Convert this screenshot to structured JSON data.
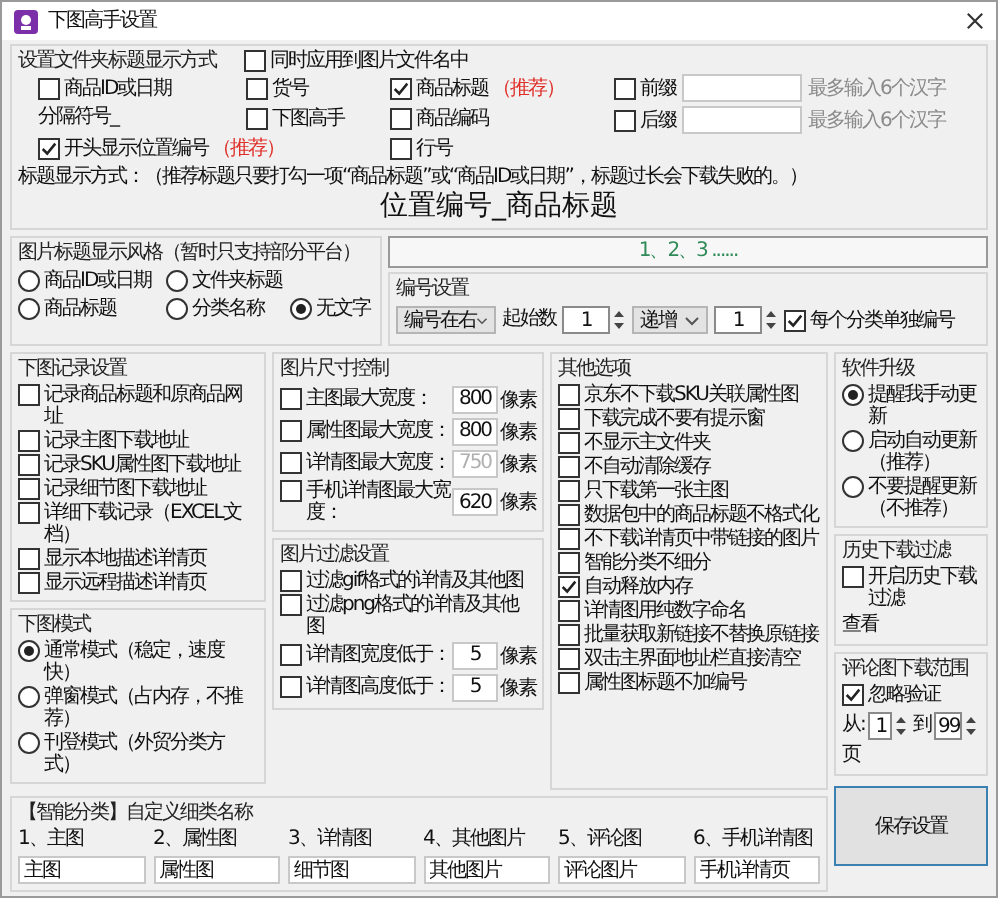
{
  "window": {
    "title": "下图高手设置"
  },
  "folder_title": {
    "heading": "设置文件夹标题显示方式",
    "apply_to_filename": {
      "label": "同时应用到图片文件名中",
      "checked": false
    },
    "rows": [
      [
        {
          "kind": "checkbox",
          "label": "商品ID或日期",
          "checked": false
        },
        {
          "kind": "checkbox",
          "label": "货号",
          "checked": false
        },
        {
          "kind": "checkbox",
          "label": "商品标题",
          "checked": true,
          "note": "（推荐）"
        }
      ],
      [
        {
          "kind": "text",
          "label": "分隔符号_"
        },
        {
          "kind": "checkbox",
          "label": "下图高手",
          "checked": false
        },
        {
          "kind": "checkbox",
          "label": "商品编码",
          "checked": false
        }
      ],
      [
        {
          "kind": "checkbox",
          "label": "开头显示位置编号",
          "checked": true,
          "note": "（推荐）"
        },
        "",
        {
          "kind": "checkbox",
          "label": "行号",
          "checked": false
        }
      ]
    ],
    "affixes": [
      {
        "label": "前缀",
        "checked": false,
        "hint": "最多输入6个汉字"
      },
      {
        "label": "后缀",
        "checked": false,
        "hint": "最多输入6个汉字"
      }
    ],
    "format_note": "标题显示方式：（推荐标题只要打勾一项“商品标题”或“商品ID或日期”，标题过长会下载失败的。）",
    "preview": "位置编号_商品标题"
  },
  "title_style": {
    "heading": "图片标题显示风格（暂时只支持部分平台）",
    "rows": [
      [
        {
          "label": "商品ID或日期",
          "selected": false
        },
        {
          "label": "文件夹标题",
          "selected": false
        }
      ],
      [
        {
          "label": "商品标题",
          "selected": false
        },
        {
          "label": "分类名称",
          "selected": false
        },
        {
          "label": "无文字",
          "selected": true
        }
      ]
    ]
  },
  "numbering": {
    "preview": "1、2、3 ......",
    "heading": "编号设置",
    "position": "编号在右",
    "start_label": "起始数",
    "start": "1",
    "order": "递增",
    "step": "1",
    "per_category": {
      "label": "每个分类单独编号",
      "checked": true
    }
  },
  "download_log": {
    "heading": "下图记录设置",
    "items": [
      {
        "label": "记录商品标题和原商品网址",
        "checked": false
      },
      {
        "label": "记录主图下载地址",
        "checked": false
      },
      {
        "label": "记录SKU属性图下载地址",
        "checked": false
      },
      {
        "label": "记录细节图下载地址",
        "checked": false
      },
      {
        "label": "详细下载记录（EXCEL文档）",
        "checked": false
      },
      {
        "label": "显示本地描述详情页",
        "checked": false
      },
      {
        "label": "显示远程描述详情页",
        "checked": false
      }
    ]
  },
  "download_mode": {
    "heading": "下图模式",
    "options": [
      {
        "label": "通常模式（稳定，速度快）",
        "selected": true
      },
      {
        "label": "弹窗模式（占内存，不推荐）",
        "selected": false
      },
      {
        "label": "刊登模式（外贸分类方式）",
        "selected": false
      }
    ]
  },
  "size_control": {
    "heading": "图片尺寸控制",
    "rows": [
      {
        "label": "主图最大宽度：",
        "checked": false,
        "value": "800",
        "unit": "像素",
        "disabled": false
      },
      {
        "label": "属性图最大宽度：",
        "checked": false,
        "value": "800",
        "unit": "像素",
        "disabled": false
      },
      {
        "label": "详情图最大宽度：",
        "checked": false,
        "value": "750",
        "unit": "像素",
        "disabled": true
      },
      {
        "label": "手机详情图最大宽度：",
        "checked": false,
        "value": "620",
        "unit": "像素",
        "disabled": false
      }
    ]
  },
  "filters": {
    "heading": "图片过滤设置",
    "items": [
      {
        "kind": "checkbox",
        "label": "过滤gif格式的详情及其他图",
        "checked": false
      },
      {
        "kind": "checkbox",
        "label": "过滤png格式的详情及其他图",
        "checked": false
      },
      {
        "kind": "input",
        "label": "详情图宽度低于：",
        "checked": false,
        "value": "5",
        "unit": "像素"
      },
      {
        "kind": "input",
        "label": "详情图高度低于：",
        "checked": false,
        "value": "5",
        "unit": "像素"
      }
    ]
  },
  "other_options": {
    "heading": "其他选项",
    "items": [
      {
        "label": "京东不下载SKU关联属性图",
        "checked": false
      },
      {
        "label": "下载完成不要有提示窗",
        "checked": false
      },
      {
        "label": "不显示主文件夹",
        "checked": false
      },
      {
        "label": "不自动清除缓存",
        "checked": false
      },
      {
        "label": "只下载第一张主图",
        "checked": false
      },
      {
        "label": "数据包中的商品标题不格式化",
        "checked": false
      },
      {
        "label": "不下载详情页中带链接的图片",
        "checked": false
      },
      {
        "label": "智能分类不细分",
        "checked": false
      },
      {
        "label": "自动释放内存",
        "checked": true
      },
      {
        "label": "详情图用纯数字命名",
        "checked": false
      },
      {
        "label": "批量获取新链接不替换原链接",
        "checked": false
      },
      {
        "label": "双击主界面地址栏直接清空",
        "checked": false
      },
      {
        "label": "属性图标题不加编号",
        "checked": false
      }
    ]
  },
  "upgrade": {
    "heading": "软件升级",
    "options": [
      {
        "label": "提醒我手动更新",
        "selected": true
      },
      {
        "label": "启动自动更新（推荐）",
        "selected": false
      },
      {
        "label": "不要提醒更新（不推荐）",
        "selected": false
      }
    ]
  },
  "history": {
    "heading": "历史下载过滤",
    "enable": {
      "label": "开启历史下载过滤",
      "checked": false
    },
    "link": "查看"
  },
  "reviews": {
    "heading": "评论图下载范围",
    "ignore": {
      "label": "忽略验证",
      "checked": true
    },
    "from_label": "从:",
    "from": "1",
    "to_label": "到",
    "to": "99",
    "unit": "页"
  },
  "save_button": "保存设置",
  "categories": {
    "heading": "【智能分类】自定义细类名称",
    "items": [
      {
        "label": "1、主图",
        "value": "主图"
      },
      {
        "label": "2、属性图",
        "value": "属性图"
      },
      {
        "label": "3、详情图",
        "value": "细节图"
      },
      {
        "label": "4、其他图片",
        "value": "其他图片"
      },
      {
        "label": "5、评论图",
        "value": "评论图片"
      },
      {
        "label": "6、手机详情图",
        "value": "手机详情页"
      }
    ]
  }
}
